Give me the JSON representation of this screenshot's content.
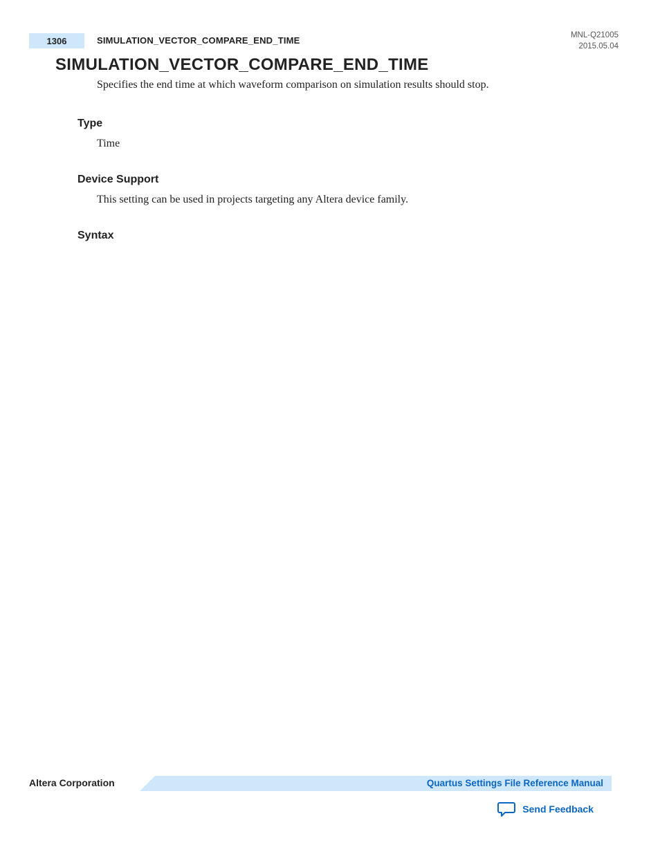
{
  "header": {
    "page_number": "1306",
    "running_title": "SIMULATION_VECTOR_COMPARE_END_TIME",
    "doc_id": "MNL-Q21005",
    "date": "2015.05.04"
  },
  "title": "SIMULATION_VECTOR_COMPARE_END_TIME",
  "intro": "Specifies the end time at which waveform comparison on simulation results should stop.",
  "sections": {
    "type": {
      "heading": "Type",
      "body": "Time"
    },
    "device_support": {
      "heading": "Device Support",
      "body": "This setting can be used in projects targeting any Altera device family."
    },
    "syntax": {
      "heading": "Syntax"
    }
  },
  "footer": {
    "left": "Altera Corporation",
    "right": "Quartus Settings File Reference Manual",
    "feedback": "Send Feedback"
  }
}
